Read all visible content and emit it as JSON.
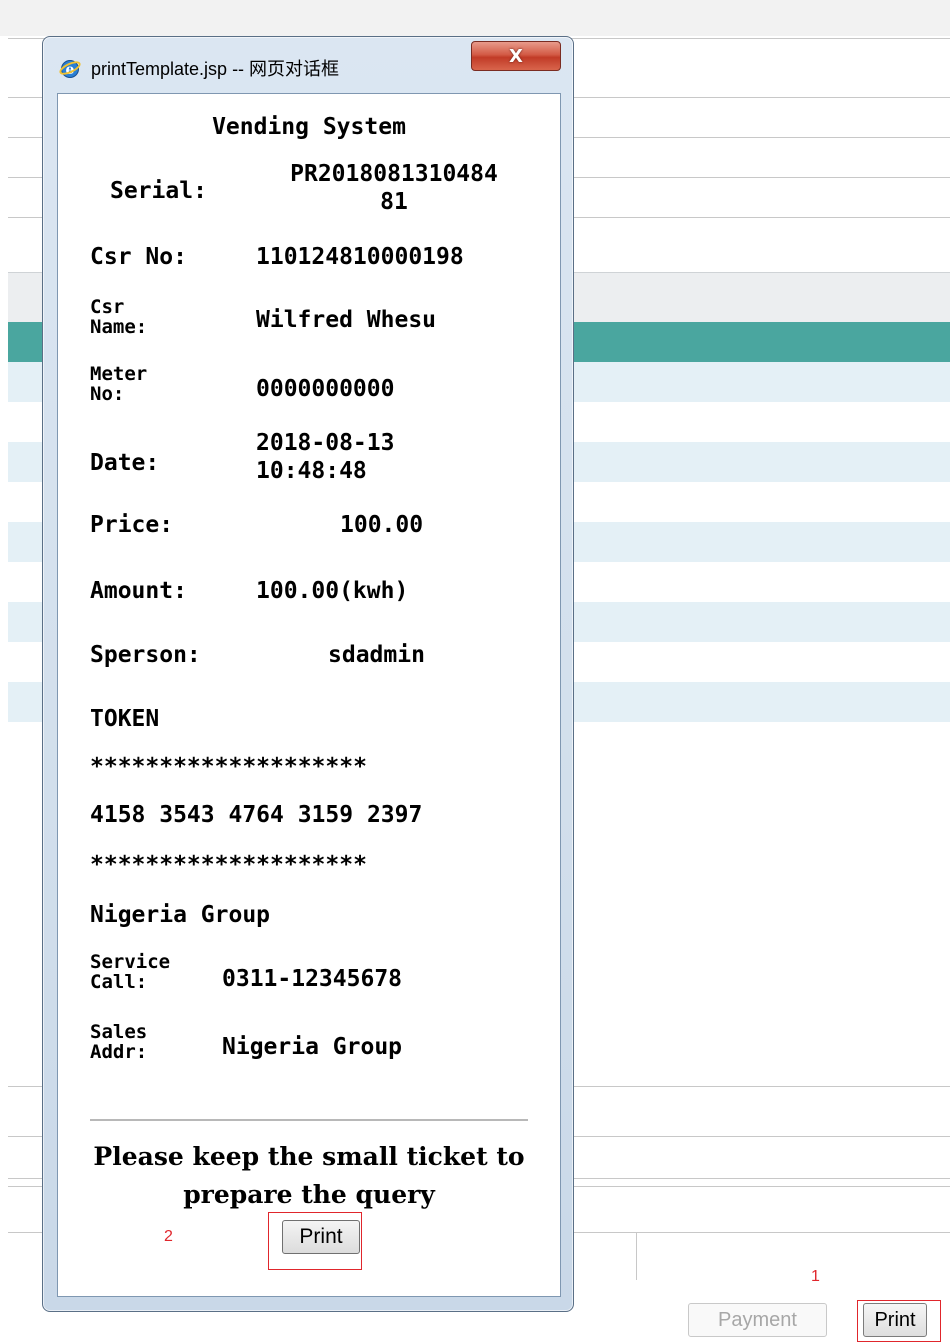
{
  "background": {
    "buttons": {
      "payment_label": "Payment",
      "print_label": "Print"
    },
    "annotations": {
      "print_main_marker": "1"
    }
  },
  "dialog": {
    "title": "printTemplate.jsp -- 网页对话框",
    "close_label": "X",
    "ticket": {
      "heading": "Vending System",
      "serial_label": "Serial:",
      "serial_value_line1": "PR2018081310484",
      "serial_value_line2": "81",
      "csr_no_label": "Csr No:",
      "csr_no_value": "110124810000198",
      "csr_name_label_line1": "Csr",
      "csr_name_label_line2": "Name:",
      "csr_name_value": "Wilfred Whesu",
      "meter_label_line1": "Meter",
      "meter_label_line2": "No:",
      "meter_value": "0000000000",
      "date_label": "Date:",
      "date_value_line1": "2018-08-13",
      "date_value_line2": "10:48:48",
      "price_label": "Price:",
      "price_value": "100.00",
      "amount_label": "Amount:",
      "amount_value": "100.00(kwh)",
      "sperson_label": "Sperson:",
      "sperson_value": "sdadmin",
      "token_heading": "TOKEN",
      "stars": "********************",
      "token_value": "4158 3543 4764 3159 2397",
      "company": "Nigeria Group",
      "service_label_line1": "Service",
      "service_label_line2": "Call:",
      "service_value": "0311-12345678",
      "sales_label_line1": "Sales",
      "sales_label_line2": "Addr:",
      "sales_value": "Nigeria Group"
    },
    "note_line1": "Please keep the small ticket to",
    "note_line2": "prepare the query",
    "print_label": "Print",
    "print_marker": "2"
  },
  "colors": {
    "teal_row": "#4aa69f",
    "stripe_row": "#e4f0f6",
    "annotation_red": "#e0262c",
    "close_button": "#c13b27"
  },
  "icons": {
    "browser": "ie-icon",
    "close": "close-icon"
  }
}
